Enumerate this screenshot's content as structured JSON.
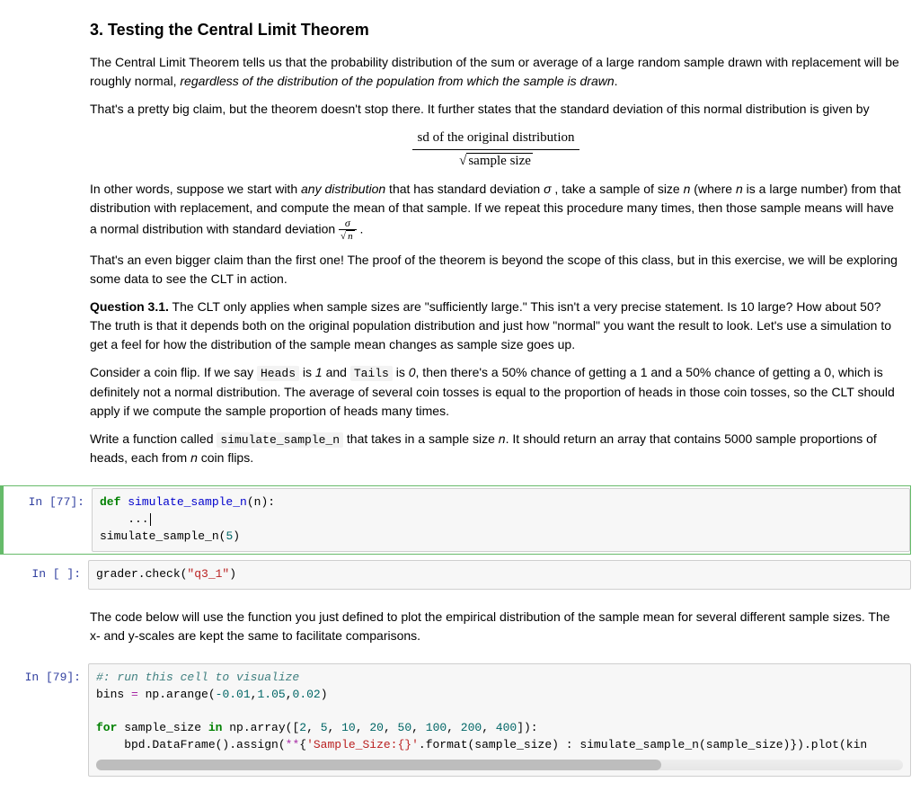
{
  "heading": "3. Testing the Central Limit Theorem",
  "para1_a": "The Central Limit Theorem tells us that the probability distribution of the sum or average of a large random sample drawn with replacement will be roughly normal, ",
  "para1_em": "regardless of the distribution of the population from which the sample is drawn",
  "para1_b": ".",
  "para2": "That's a pretty big claim, but the theorem doesn't stop there. It further states that the standard deviation of this normal distribution is given by",
  "formula_num": "sd of the original distribution",
  "formula_den": "sample size",
  "para3_a": "In other words, suppose we start with ",
  "para3_em": "any distribution",
  "para3_b": " that has standard deviation ",
  "sigma": "σ",
  "para3_c": " , take a sample of size ",
  "n": "n",
  "para3_d": " (where ",
  "para3_e": " is a large number) from that distribution with replacement, and compute the mean of that sample. If we repeat this procedure many times, then those sample means will have a normal distribution with standard deviation ",
  "para3_f": " .",
  "para4": "That's an even bigger claim than the first one! The proof of the theorem is beyond the scope of this class, but in this exercise, we will be exploring some data to see the CLT in action.",
  "q31_label": "Question 3.1.",
  "q31_text": " The CLT only applies when sample sizes are \"sufficiently large.\" This isn't a very precise statement. Is 10 large? How about 50? The truth is that it depends both on the original population distribution and just how \"normal\" you want the result to look. Let's use a simulation to get a feel for how the distribution of the sample mean changes as sample size goes up.",
  "q31_p2_a": "Consider a coin flip. If we say ",
  "code_heads": "Heads",
  "q31_p2_b": " is ",
  "one": "1",
  "q31_p2_c": " and ",
  "code_tails": "Tails",
  "q31_p2_d": " is ",
  "zero": "0",
  "q31_p2_e": ", then there's a 50% chance of getting a 1 and a 50% chance of getting a 0, which is definitely not a normal distribution. The average of several coin tosses is equal to the proportion of heads in those coin tosses, so the CLT should apply if we compute the sample proportion of heads many times.",
  "q31_p3_a": "Write a function called ",
  "code_sim": "simulate_sample_n",
  "q31_p3_b": " that takes in a sample size ",
  "q31_p3_c": ". It should return an array that contains 5000 sample proportions of heads, each from ",
  "q31_p3_d": " coin flips.",
  "cell1_prompt": "In [77]:",
  "cell1_code": {
    "def": "def",
    "funcname": "simulate_sample_n",
    "sig": "(n):",
    "ellipsis": "    ...",
    "call": "simulate_sample_n(",
    "five": "5",
    "close": ")"
  },
  "cell2_prompt": "In [ ]:",
  "cell2_code": "grader.check(",
  "cell2_str": "\"q3_1\"",
  "cell2_close": ")",
  "para5": "The code below will use the function you just defined to plot the empirical distribution of the sample mean for several different sample sizes. The x- and y-scales are kept the same to facilitate comparisons.",
  "cell3_prompt": "In [79]:",
  "cell3": {
    "comment": "#: run this cell to visualize",
    "l2a": "bins ",
    "l2eq": "=",
    "l2b": " np.arange(",
    "n1": "-0.01",
    "n2": "1.05",
    "n3": "0.02",
    "l2c": ")",
    "l4a": "for",
    "l4b": " sample_size ",
    "l4c": "in",
    "l4d": " np.array([",
    "arr": [
      "2",
      "5",
      "10",
      "20",
      "50",
      "100",
      "200",
      "400"
    ],
    "l4e": "]):",
    "l5a": "    bpd.DataFrame().assign(",
    "l5op": "**",
    "l5b": "{",
    "l5str": "'Sample_Size:{}'",
    "l5c": ".format(sample_size) : simulate_sample_n(sample_size)}).plot(kin"
  }
}
